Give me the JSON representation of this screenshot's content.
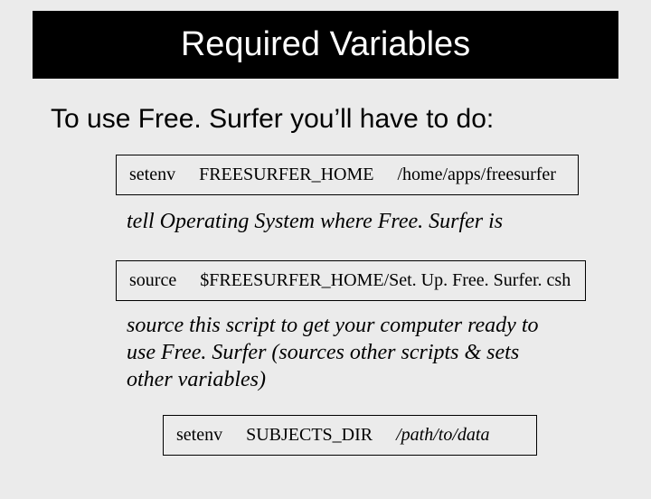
{
  "title": "Required Variables",
  "subtitle": "To use Free. Surfer you’ll have to do:",
  "box1": {
    "cmd": "setenv",
    "var": "FREESURFER_HOME",
    "val": "/home/apps/freesurfer"
  },
  "caption1": "tell Operating System where Free. Surfer is",
  "box2": {
    "cmd": "source",
    "val": "$FREESURFER_HOME/Set. Up. Free. Surfer. csh"
  },
  "caption2": "source this script to get your computer ready to use Free. Surfer (sources other scripts & sets other variables)",
  "box3": {
    "cmd": "setenv",
    "var": "SUBJECTS_DIR",
    "val": "/path/to/data"
  }
}
